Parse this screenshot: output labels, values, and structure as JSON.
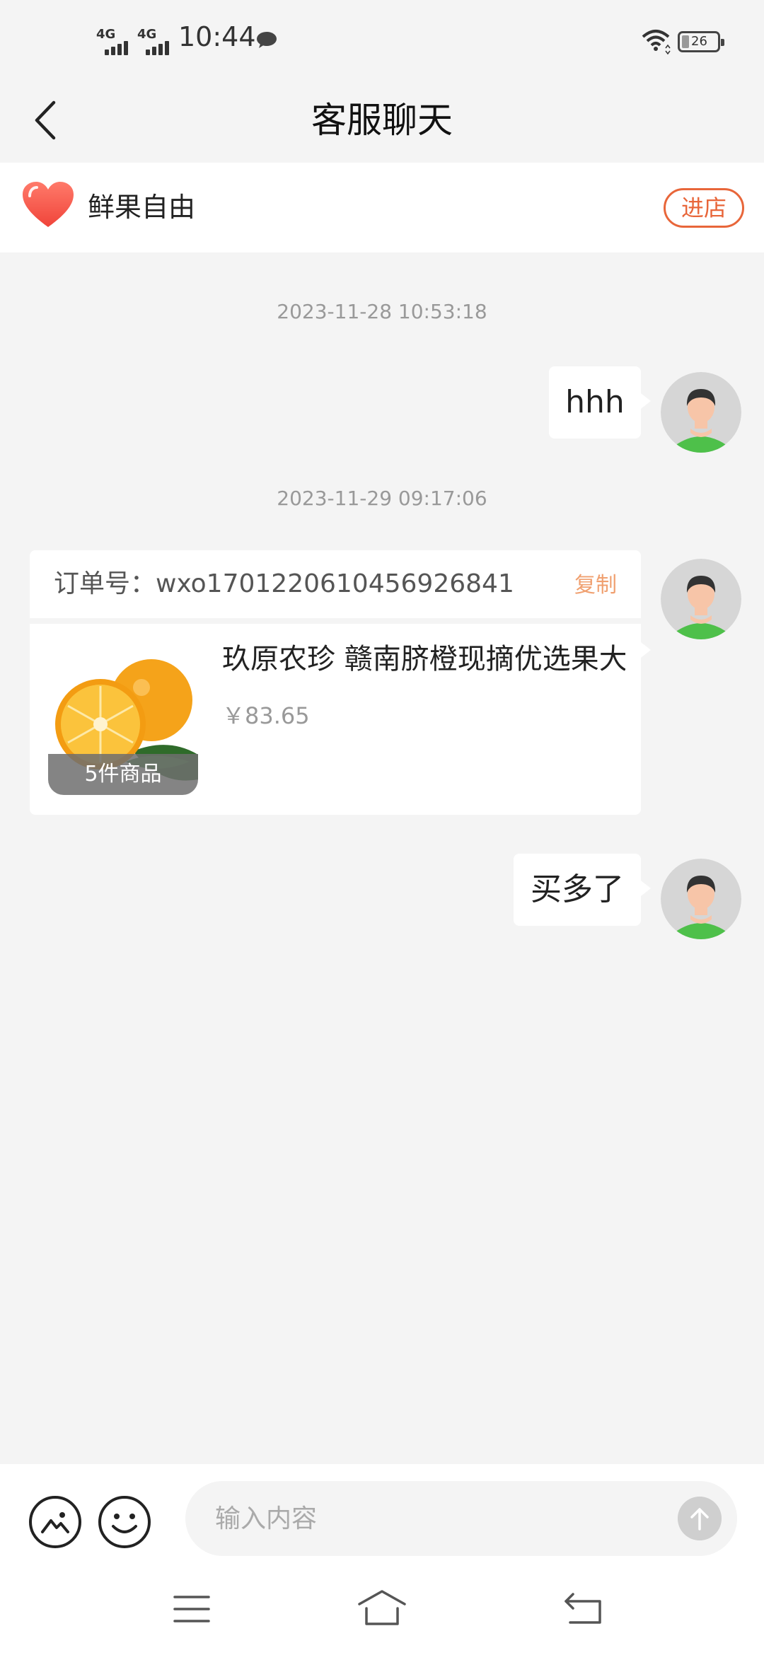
{
  "status_bar": {
    "network_1": "4G",
    "network_2": "4G",
    "time": "10:44",
    "battery": "26"
  },
  "header": {
    "title": "客服聊天",
    "back_icon": "chevron-left-icon"
  },
  "shop": {
    "icon": "heart-icon",
    "name": "鲜果自由",
    "enter_label": "进店",
    "accent_color": "#e8663a"
  },
  "messages": [
    {
      "timestamp": "2023-11-28 10:53:18",
      "text": "hhh"
    },
    {
      "timestamp": "2023-11-29 09:17:06",
      "order": {
        "label": "订单号：wxo1701220610456926841",
        "copy_label": "复制",
        "product_title": "玖原农珍 赣南脐橙现摘优选果大...",
        "price": "￥83.65",
        "quantity_label": "5件商品"
      }
    },
    {
      "text": "买多了"
    }
  ],
  "input": {
    "placeholder": "输入内容",
    "image_icon": "image-icon",
    "emoji_icon": "emoji-icon",
    "send_icon": "arrow-up-icon"
  },
  "nav": {
    "icons": [
      "menu-icon",
      "home-icon",
      "back-icon"
    ]
  }
}
